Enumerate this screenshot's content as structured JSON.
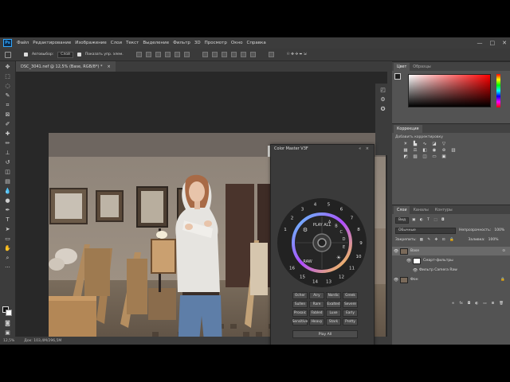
{
  "menu": {
    "logo": "Ps",
    "items": [
      "Файл",
      "Редактирование",
      "Изображение",
      "Слои",
      "Текст",
      "Выделение",
      "Фильтр",
      "3D",
      "Просмотр",
      "Окно",
      "Справка"
    ],
    "window_controls": [
      "—",
      "□",
      "✕"
    ]
  },
  "options": {
    "autoselect_label": "Автовыбор:",
    "autoselect_value": "Слой",
    "show_controls_label": "Показать упр. элем."
  },
  "document": {
    "tab_title": "DSC_3041.nef @ 12,5% (Base, RGB/8*) *",
    "tab_close": "×",
    "zoom": "12,5%",
    "doc_size": "Док: 103,4M/296,5M"
  },
  "color_master": {
    "title": "Color Master V3F",
    "controls": "«  ×",
    "play_all": "PLAY ALL",
    "raw": "RAW",
    "dial_numbers": [
      "1",
      "2",
      "3",
      "4",
      "5",
      "6",
      "7",
      "8",
      "9",
      "10",
      "11",
      "12",
      "13",
      "14",
      "15",
      "16"
    ],
    "dial_letters": [
      "A",
      "B",
      "C",
      "D",
      "E"
    ],
    "presets": [
      "Ocher",
      "Airy",
      "Nordic",
      "Greek",
      "Sullen",
      "Rare",
      "Exalted",
      "Severe",
      "Prosaic",
      "Fabled",
      "Luxe",
      "Early",
      "Sensitive",
      "Heavy",
      "Stark",
      "Pretty"
    ],
    "play_all_button": "Play All",
    "colors": {
      "ring_start": "#5ec8ff",
      "ring_mid": "#b04cff",
      "ring_end": "#ffd23c",
      "dial_bg": "#2a2a2a"
    }
  },
  "panels": {
    "color_tabs": [
      "Цвет",
      "Образцы"
    ],
    "adjust_tabs": [
      "Коррекция"
    ],
    "adjust_hint": "Добавить корректировку",
    "layers_tabs": [
      "Слои",
      "Каналы",
      "Контуры"
    ],
    "filter_kind": "Вид",
    "blend_mode": "Обычные",
    "opacity_label": "Непрозрачность:",
    "opacity_value": "100%",
    "lock_label": "Закрепить:",
    "fill_label": "Заливка:",
    "fill_value": "100%",
    "layers": [
      {
        "name": "Base",
        "selected": true
      },
      {
        "name": "Смарт-фильтры",
        "selected": false
      },
      {
        "name": "Фильтр Camera Raw",
        "selected": false
      },
      {
        "name": "Фон",
        "selected": false
      }
    ]
  }
}
